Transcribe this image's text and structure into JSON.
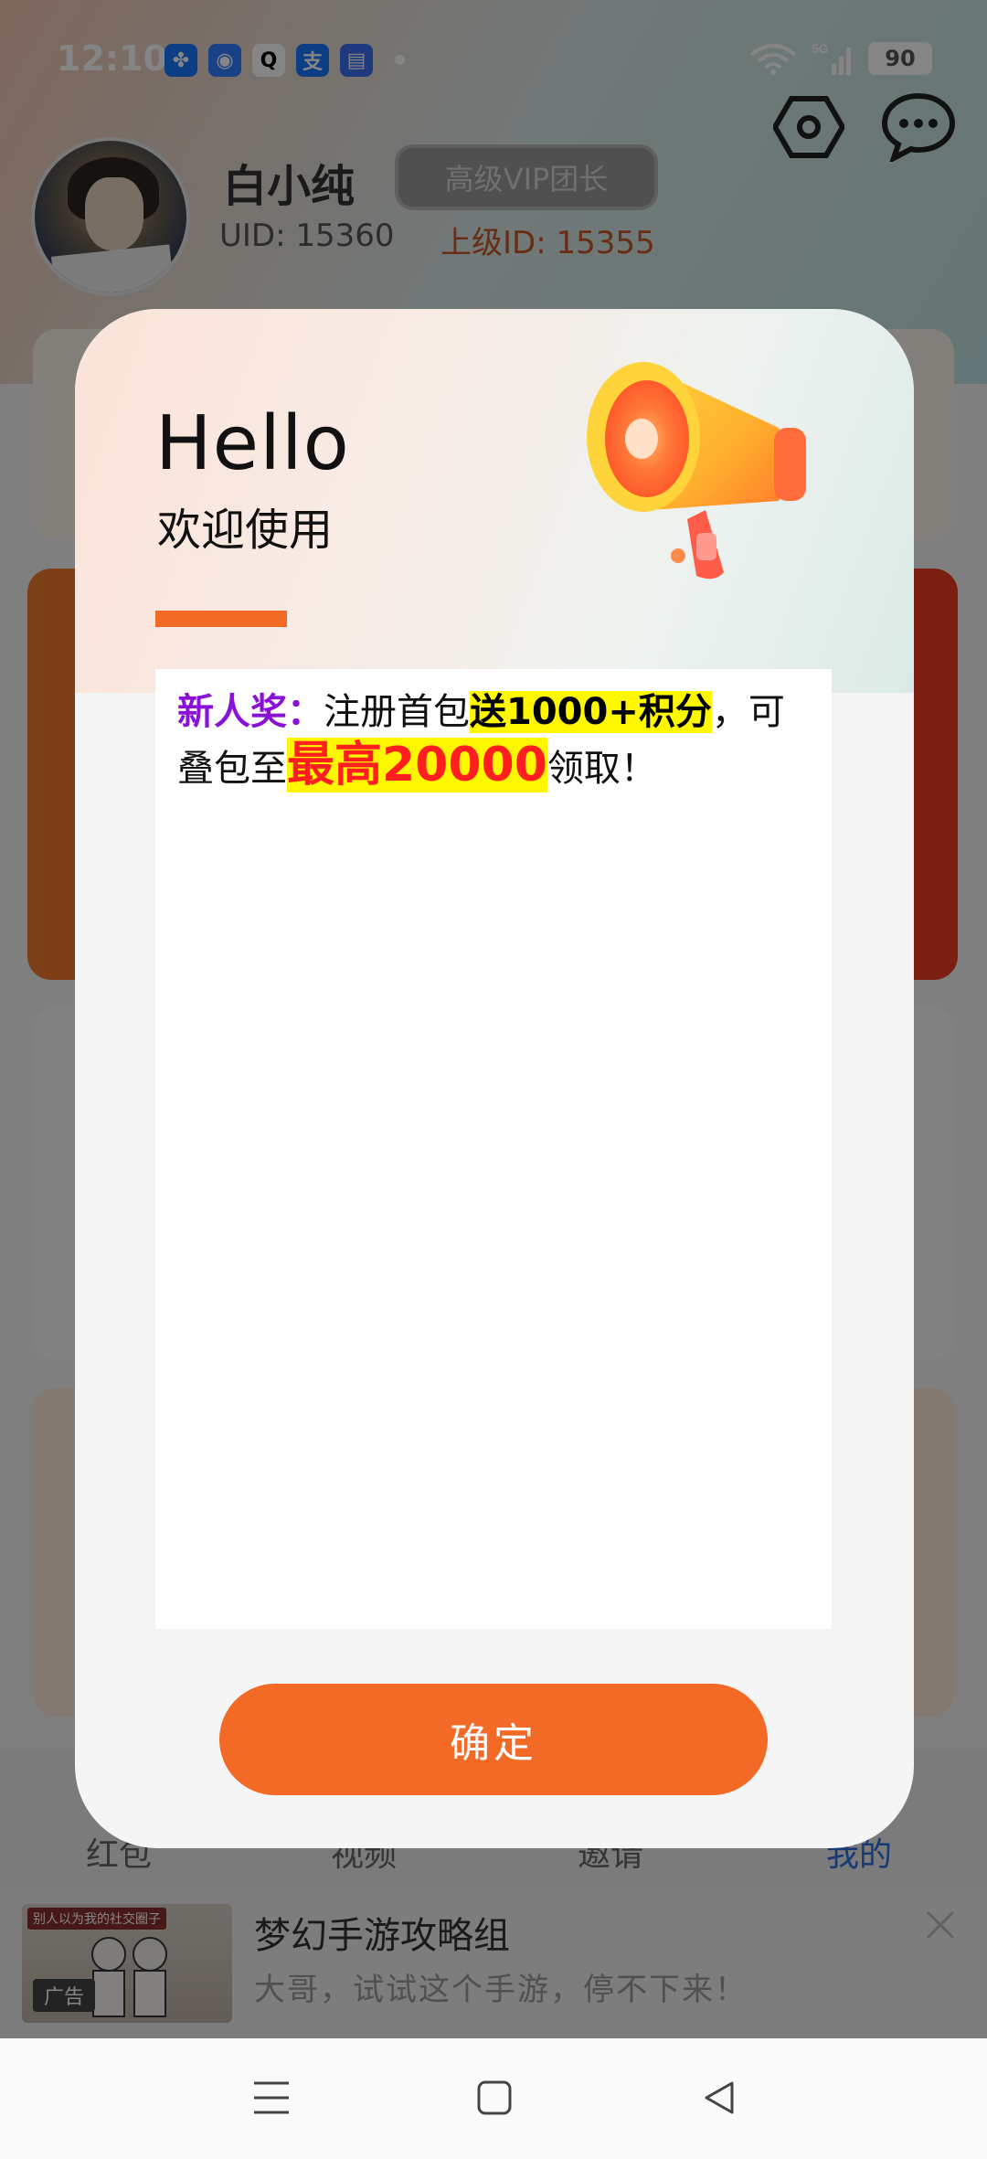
{
  "status_bar": {
    "time": "12:10",
    "network": "5G",
    "wifi_sub": "6",
    "battery": "90",
    "apps": [
      {
        "icon": "pinwheel-icon",
        "color": "#1677ff",
        "glyph": "✤"
      },
      {
        "icon": "browser-icon",
        "color": "#2f7fff",
        "glyph": "◉"
      },
      {
        "icon": "qq-icon",
        "color": "#ffffff",
        "glyph": "🐧"
      },
      {
        "icon": "alipay-icon",
        "color": "#1677ff",
        "glyph": "支"
      },
      {
        "icon": "message-app-icon",
        "color": "#3d6df2",
        "glyph": "▤"
      }
    ]
  },
  "profile": {
    "name": "白小纯",
    "vip_badge": "高级VIP团长",
    "uid": "UID: 15360",
    "parent_id": "上级ID: 15355"
  },
  "modal": {
    "hello": "Hello",
    "welcome": "欢迎使用",
    "content": {
      "label": "新人奖：",
      "part1": "注册首包",
      "highlight1": "送1000+积分",
      "part2": "，可叠包至",
      "highlight2": "最高20000",
      "part3": "领取！"
    },
    "confirm": "确定"
  },
  "bottom_tabs": [
    "红包",
    "视频",
    "邀请",
    "我的"
  ],
  "ad": {
    "title": "梦幻手游攻略组",
    "description": "大哥，试试这个手游，停不下来！",
    "thumb_title": "别人以为我的社交圈子",
    "thumb_tag": "广告"
  },
  "colors": {
    "accent": "#f26a25",
    "label_purple": "#8a12d6",
    "highlight_yellow": "#fff700",
    "big_red": "#ff1f1f"
  }
}
